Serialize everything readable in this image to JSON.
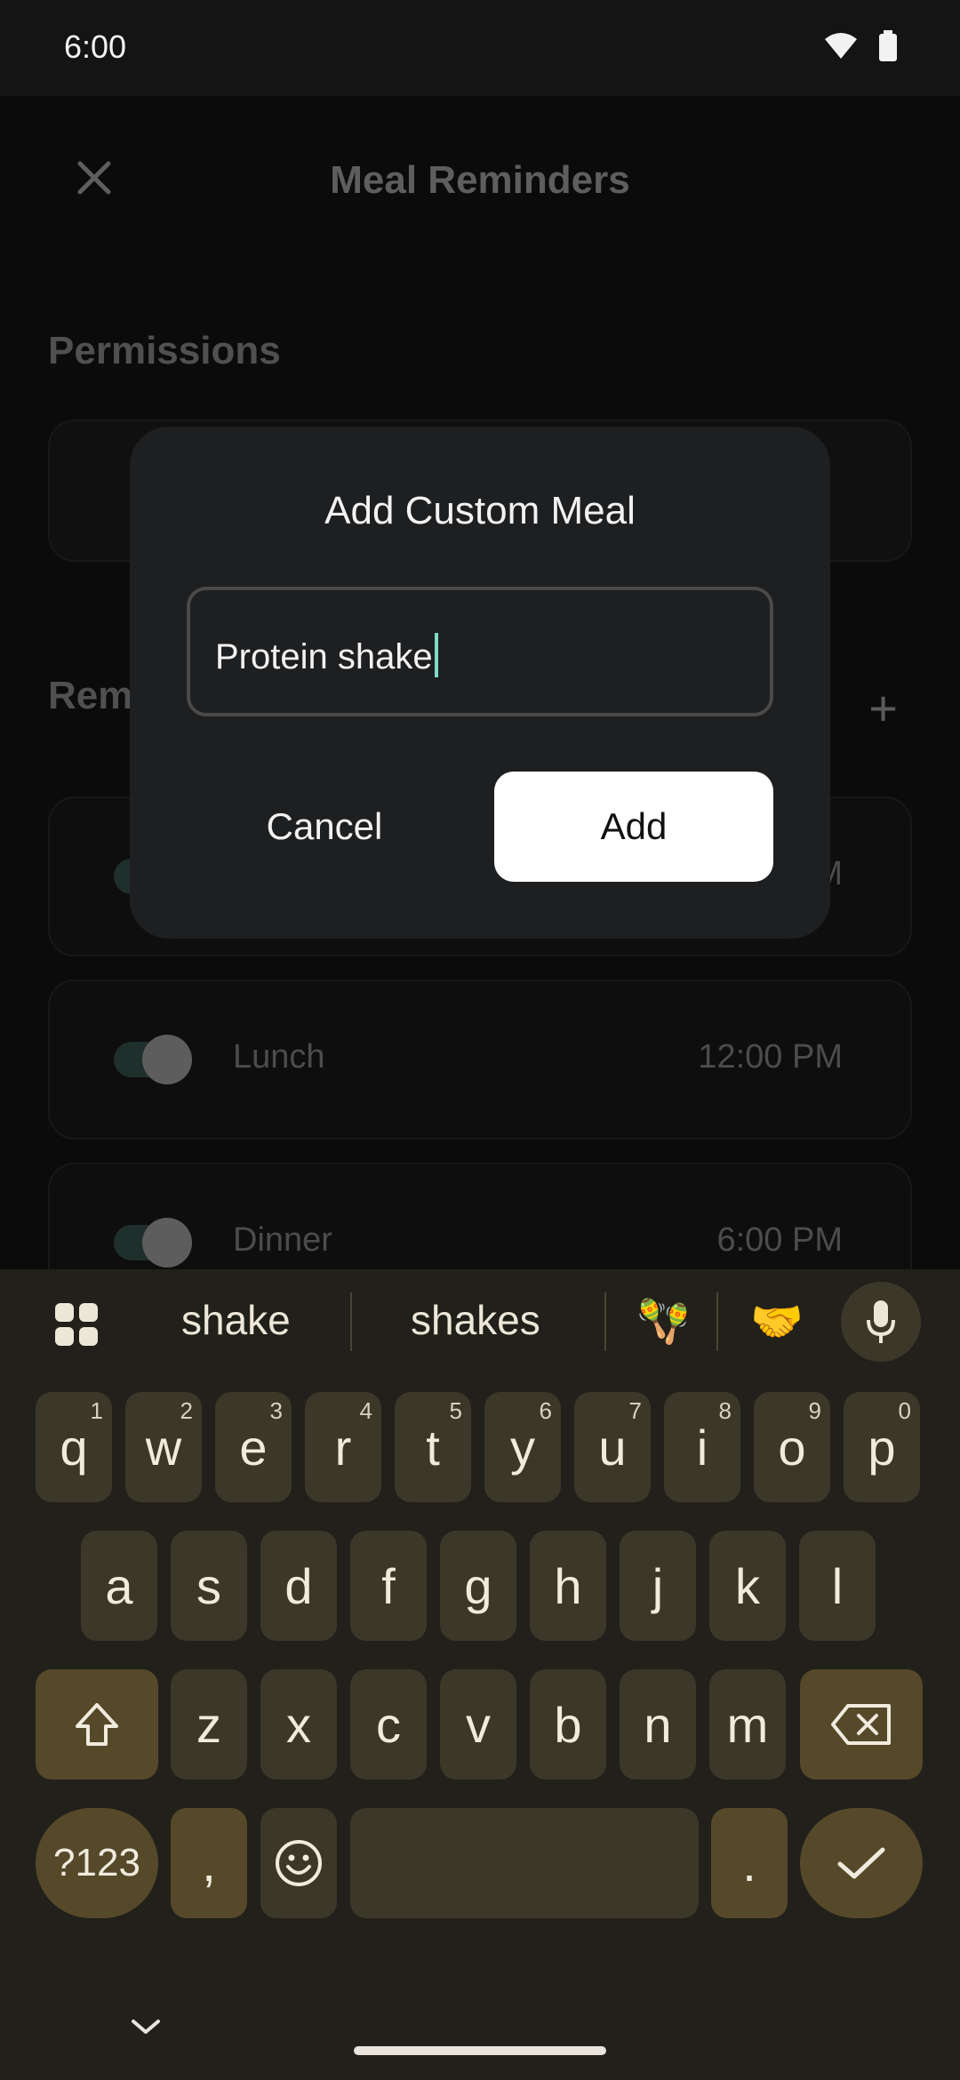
{
  "status": {
    "time": "6:00",
    "icons": [
      "wifi-icon",
      "battery-icon"
    ]
  },
  "app": {
    "title": "Meal Reminders",
    "sections": {
      "permissions": "Permissions",
      "reminders": "Rem"
    },
    "rows": [
      {
        "label": "",
        "time": "M"
      },
      {
        "label": "Lunch",
        "time": "12:00 PM"
      },
      {
        "label": "Dinner",
        "time": "6:00 PM"
      }
    ]
  },
  "dialog": {
    "title": "Add Custom Meal",
    "input_value": "Protein shake",
    "cancel_label": "Cancel",
    "add_label": "Add"
  },
  "keyboard": {
    "suggestions": [
      "shake",
      "shakes"
    ],
    "emoji_suggestions": [
      "🪇",
      "🤝"
    ],
    "row1": [
      {
        "k": "q",
        "n": "1"
      },
      {
        "k": "w",
        "n": "2"
      },
      {
        "k": "e",
        "n": "3"
      },
      {
        "k": "r",
        "n": "4"
      },
      {
        "k": "t",
        "n": "5"
      },
      {
        "k": "y",
        "n": "6"
      },
      {
        "k": "u",
        "n": "7"
      },
      {
        "k": "i",
        "n": "8"
      },
      {
        "k": "o",
        "n": "9"
      },
      {
        "k": "p",
        "n": "0"
      }
    ],
    "row2": [
      "a",
      "s",
      "d",
      "f",
      "g",
      "h",
      "j",
      "k",
      "l"
    ],
    "row3": [
      "z",
      "x",
      "c",
      "v",
      "b",
      "n",
      "m"
    ],
    "symbols_label": "?123",
    "comma": ",",
    "period": "."
  },
  "colors": {
    "accent": "#7ddbc9",
    "keyboard_bg": "#22201a",
    "key_bg": "#3b3829",
    "key_function_bg": "#55492a"
  }
}
